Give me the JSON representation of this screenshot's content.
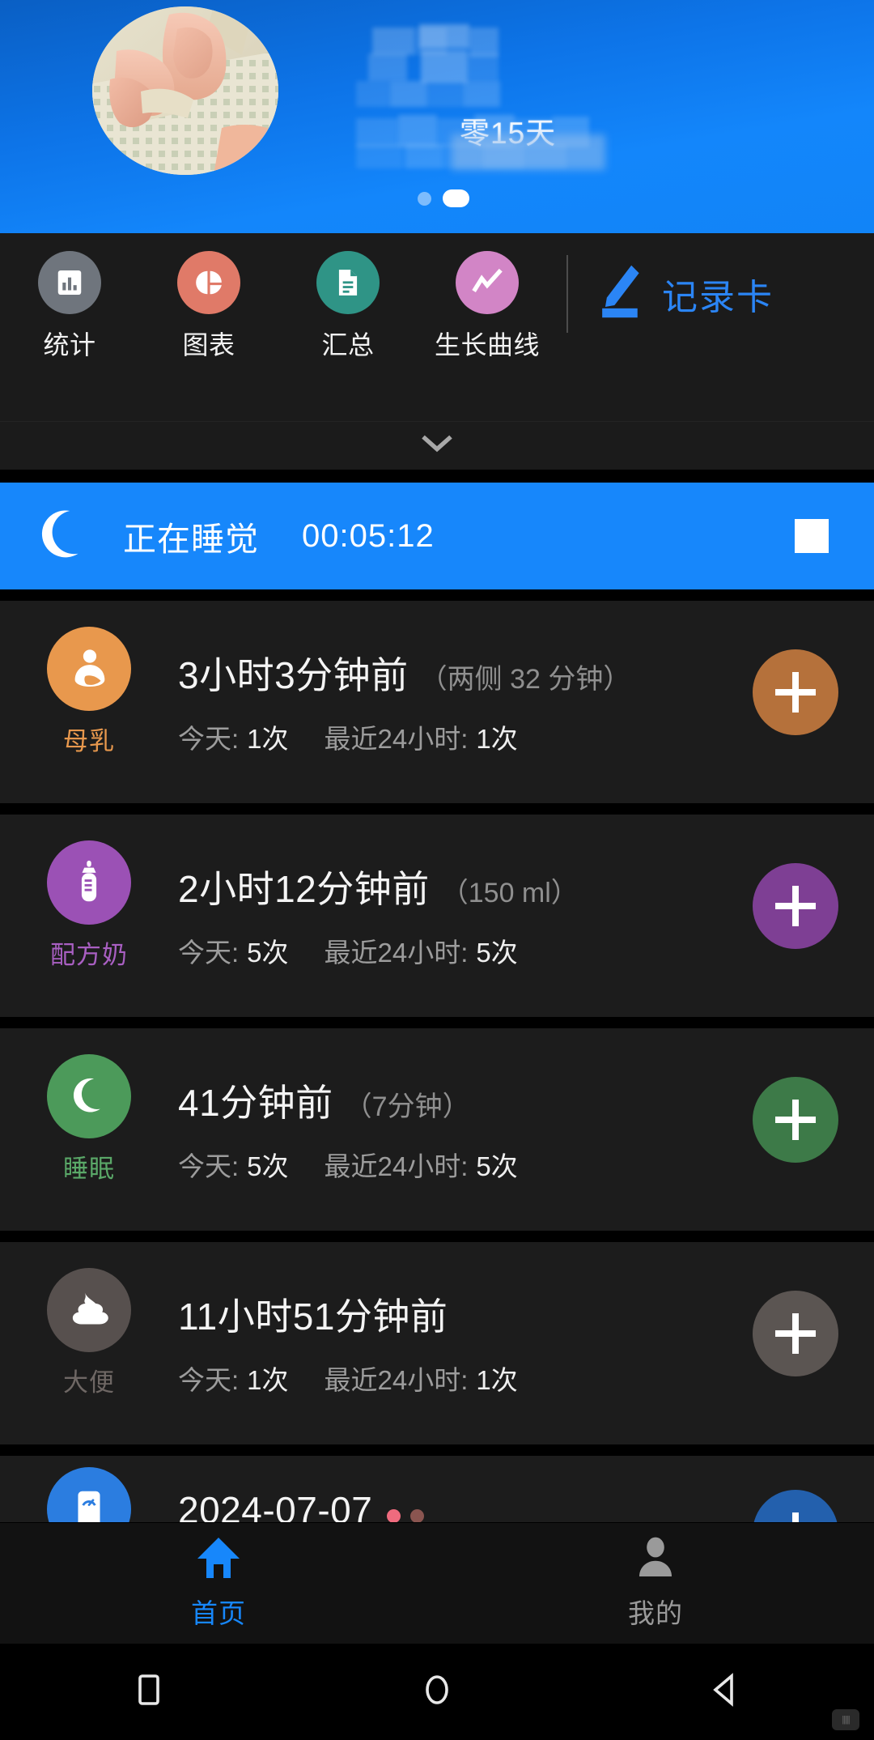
{
  "header": {
    "profile_partial_text": "零15天",
    "page_dots": 2,
    "active_dot_index": 1,
    "accent_blue": "#1787fb"
  },
  "toolbar": {
    "tools": [
      {
        "label": "统计",
        "icon": "bar-chart-icon",
        "color": "#6f757d"
      },
      {
        "label": "图表",
        "icon": "pie-chart-icon",
        "color": "#e07a68"
      },
      {
        "label": "汇总",
        "icon": "document-icon",
        "color": "#2f9486"
      },
      {
        "label": "生长曲线",
        "icon": "line-chart-icon",
        "color": "#d285c6"
      }
    ],
    "record_card": {
      "label": "记录卡",
      "icon": "pencil-icon",
      "color": "#2b85f5"
    },
    "expander_icon": "chevron-down-icon"
  },
  "sleep_banner": {
    "icon": "moon-icon",
    "label": "正在睡觉",
    "timer": "00:05:12",
    "stop_icon": "stop-square-icon",
    "background": "#1787fb"
  },
  "rows": [
    {
      "icon": "breastfeeding-icon",
      "icon_label": "母乳",
      "circle_color": "#e8984d",
      "label_color": "#e8984d",
      "add_color": "#b5713b",
      "primary": "3小时3分钟前",
      "secondary": "（两侧 32 分钟）",
      "stats": [
        {
          "key": "今天:",
          "value": "1次"
        },
        {
          "key": "最近24小时:",
          "value": "1次"
        }
      ]
    },
    {
      "icon": "bottle-icon",
      "icon_label": "配方奶",
      "circle_color": "#9b51b5",
      "label_color": "#a95fc2",
      "add_color": "#7e3f94",
      "primary": "2小时12分钟前",
      "secondary": "（150 ml）",
      "stats": [
        {
          "key": "今天:",
          "value": "5次"
        },
        {
          "key": "最近24小时:",
          "value": "5次"
        }
      ]
    },
    {
      "icon": "crescent-moon-icon",
      "icon_label": "睡眠",
      "circle_color": "#4c9a5a",
      "label_color": "#5aa868",
      "add_color": "#3d7a48",
      "primary": "41分钟前",
      "secondary": "（7分钟）",
      "stats": [
        {
          "key": "今天:",
          "value": "5次"
        },
        {
          "key": "最近24小时:",
          "value": "5次"
        }
      ]
    },
    {
      "icon": "poop-icon",
      "icon_label": "大便",
      "circle_color": "#57504e",
      "label_color": "#6e6764",
      "add_color": "#5b5552",
      "primary": "11小时51分钟前",
      "secondary": "",
      "stats": [
        {
          "key": "今天:",
          "value": "1次"
        },
        {
          "key": "最近24小时:",
          "value": "1次"
        }
      ]
    },
    {
      "icon": "scale-icon",
      "icon_label": "",
      "circle_color": "#2b7de0",
      "label_color": "#2b7de0",
      "add_color": "#2360ad",
      "primary": "2024-07-07",
      "secondary": "",
      "marker_dots": [
        "#ef6b7e",
        "#8a5550"
      ],
      "stats": []
    }
  ],
  "bottom_nav": [
    {
      "label": "首页",
      "icon": "home-icon",
      "active": true,
      "color": "#1787fb"
    },
    {
      "label": "我的",
      "icon": "person-icon",
      "active": false,
      "color": "#9a9a9a"
    }
  ],
  "android_nav": [
    {
      "icon": "recents-square-icon"
    },
    {
      "icon": "home-circle-icon"
    },
    {
      "icon": "back-triangle-icon"
    }
  ]
}
